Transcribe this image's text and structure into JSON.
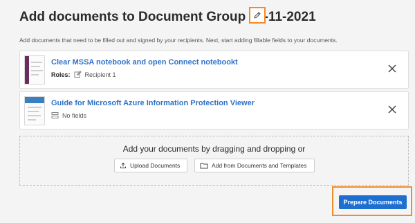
{
  "header": {
    "title": "Add documents to Document Group 30-11-2021",
    "subtitle": "Add documents that need to be filled out and signed by your recipients. Next, start adding fillable fields to your documents."
  },
  "documents": [
    {
      "title": "Clear MSSA notebook and open Connect notebookt",
      "roles_label": "Roles:",
      "meta": "Recipient 1",
      "meta_icon": "edit-square-icon",
      "thumb_band_color": "#6b2d5c"
    },
    {
      "title": "Guide for Microsoft Azure Information Protection Viewer",
      "meta": "No fields",
      "meta_icon": "fields-icon",
      "thumb_band_color": "#3a7fc1"
    }
  ],
  "dropzone": {
    "text": "Add your documents by dragging and dropping or",
    "upload_label": "Upload Documents",
    "add_label": "Add from Documents and Templates"
  },
  "actions": {
    "prepare_label": "Prepare Documents"
  },
  "colors": {
    "accent": "#1f6fd1",
    "link": "#2e73c9",
    "highlight": "#f28c28"
  }
}
